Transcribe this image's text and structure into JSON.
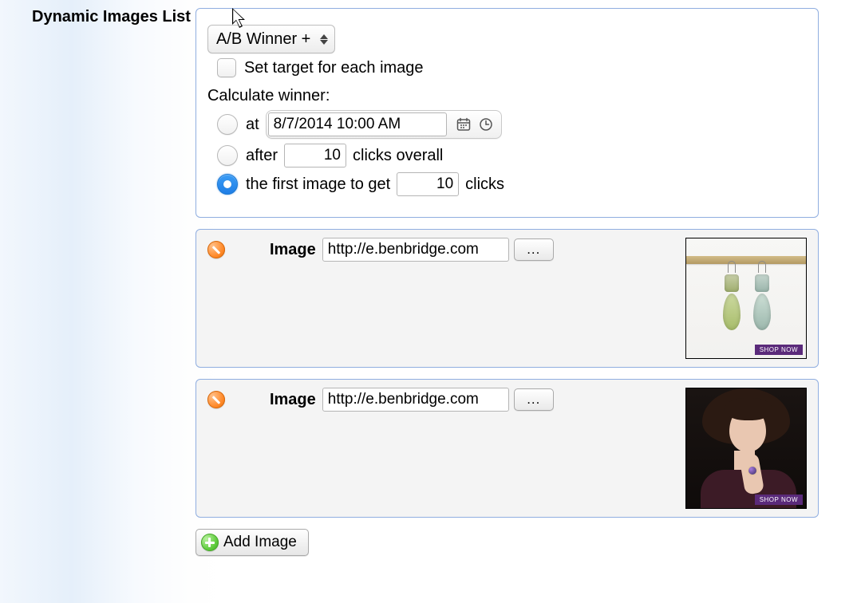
{
  "section_title": "Dynamic Images List",
  "selector": {
    "value": "A/B Winner +"
  },
  "set_target_label": "Set target for each image",
  "calc_label": "Calculate winner:",
  "opts": {
    "at": {
      "label": "at",
      "datetime": "8/7/2014 10:00 AM"
    },
    "after": {
      "label": "after",
      "count": "10",
      "suffix": "clicks overall"
    },
    "first": {
      "prefix": "the first image to get",
      "count": "10",
      "suffix": "clicks"
    },
    "selected": "first"
  },
  "image_label": "Image",
  "browse_label": "...",
  "images": [
    {
      "url": "http://e.benbridge.com",
      "cta": "SHOP NOW"
    },
    {
      "url": "http://e.benbridge.com",
      "cta": "SHOP NOW"
    }
  ],
  "add_label": "Add Image"
}
